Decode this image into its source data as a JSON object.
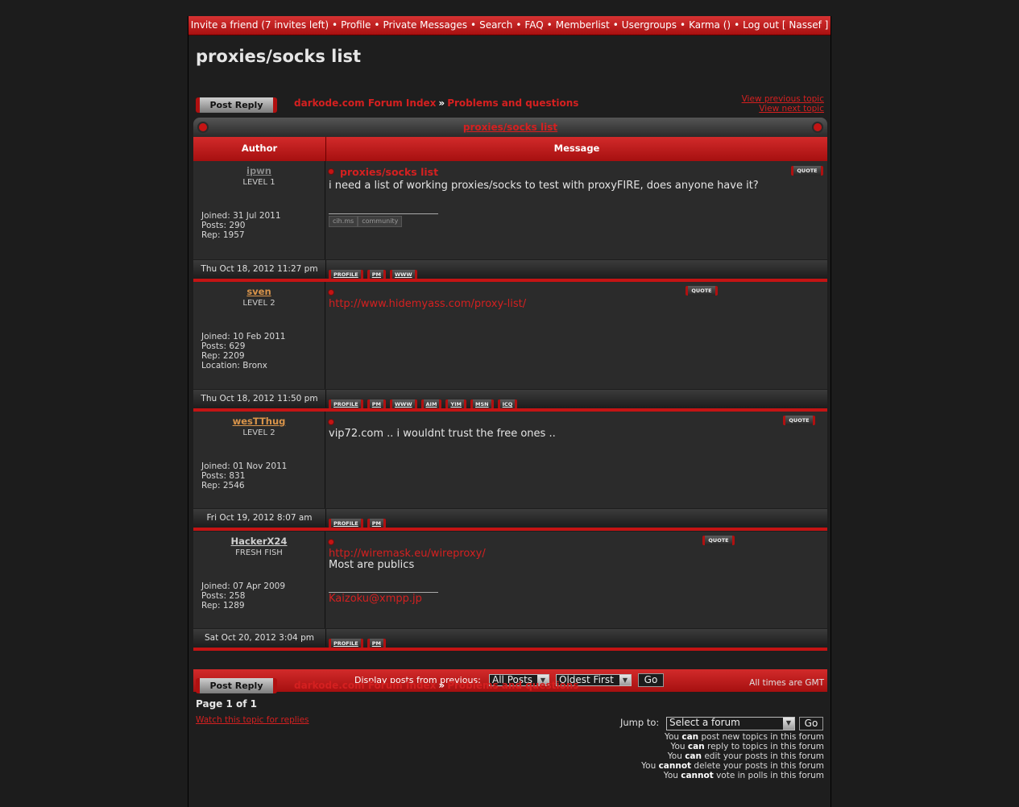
{
  "nav": {
    "items": [
      "Invite a friend (7 invites left)",
      "Profile",
      "Private Messages",
      "Search",
      "FAQ",
      "Memberlist",
      "Usergroups",
      "Karma ()",
      "Log out [ Nassef ]"
    ],
    "separator": "•"
  },
  "page_title": "proxies/socks list",
  "post_reply_label": "Post Reply",
  "breadcrumb": {
    "forum_index": "darkode.com Forum Index",
    "arrow": "»",
    "forum": "Problems and questions"
  },
  "topic_links": {
    "previous": "View previous topic",
    "next": "View next topic"
  },
  "table": {
    "caption": "proxies/socks list",
    "col_author": "Author",
    "col_message": "Message"
  },
  "labels": {
    "joined": "Joined:",
    "posts": "Posts:",
    "rep": "Rep:",
    "location": "Location:",
    "quote": "QUOTE"
  },
  "posts": [
    {
      "author": "ipwn",
      "author_color": "#888888",
      "rank": "LEVEL 1",
      "joined": "31 Jul 2011",
      "posts": "290",
      "rep": "1957",
      "title": "proxies/socks list",
      "text": "i need a list of working proxies/socks to test with proxyFIRE, does anyone have it?",
      "signature_badges": [
        "cih.ms",
        "community"
      ],
      "date": "Thu Oct 18, 2012 11:27 pm",
      "buttons": [
        "PROFILE",
        "PM",
        "WWW"
      ]
    },
    {
      "author": "sven",
      "author_color": "#d9944a",
      "rank": "LEVEL 2",
      "joined": "10 Feb 2011",
      "posts": "629",
      "rep": "2209",
      "location": "Bronx",
      "title": "",
      "link": "http://www.hidemyass.com/proxy-list/",
      "date": "Thu Oct 18, 2012 11:50 pm",
      "buttons": [
        "PROFILE",
        "PM",
        "WWW",
        "AIM",
        "YIM",
        "MSN",
        "ICQ"
      ]
    },
    {
      "author": "wesTThug",
      "author_color": "#d9944a",
      "rank": "LEVEL 2",
      "joined": "01 Nov 2011",
      "posts": "831",
      "rep": "2546",
      "title": "",
      "text": "vip72.com .. i wouldnt trust the free ones ..",
      "date": "Fri Oct 19, 2012 8:07 am",
      "buttons": [
        "PROFILE",
        "PM"
      ]
    },
    {
      "author": "HackerX24",
      "author_color": "#cfcfcf",
      "rank": "FRESH FISH",
      "joined": "07 Apr 2009",
      "posts": "258",
      "rep": "1289",
      "title": "",
      "link": "http://wiremask.eu/wireproxy/",
      "text": "Most are publics",
      "signature": "Kaizoku@xmpp.jp",
      "date": "Sat Oct 20, 2012 3:04 pm",
      "buttons": [
        "PROFILE",
        "PM"
      ]
    }
  ],
  "display": {
    "label": "Display posts from previous:",
    "range_value": "All Posts",
    "order_value": "Oldest First",
    "go_label": "Go"
  },
  "footer": {
    "gmt": "All times are GMT",
    "page": "Page 1 of 1",
    "watch": "Watch this topic for replies",
    "jump_label": "Jump to:",
    "jump_value": "Select a forum",
    "jump_go": "Go"
  },
  "permissions": [
    {
      "pre": "You ",
      "verb": "can",
      "post": " post new topics in this forum"
    },
    {
      "pre": "You ",
      "verb": "can",
      "post": " reply to topics in this forum"
    },
    {
      "pre": "You ",
      "verb": "can",
      "post": " edit your posts in this forum"
    },
    {
      "pre": "You ",
      "verb": "cannot",
      "post": " delete your posts in this forum"
    },
    {
      "pre": "You ",
      "verb": "cannot",
      "post": " vote in polls in this forum"
    }
  ],
  "colors": {
    "accent": "#d42020",
    "bar": "#c41414",
    "background": "#1e1e1e"
  }
}
